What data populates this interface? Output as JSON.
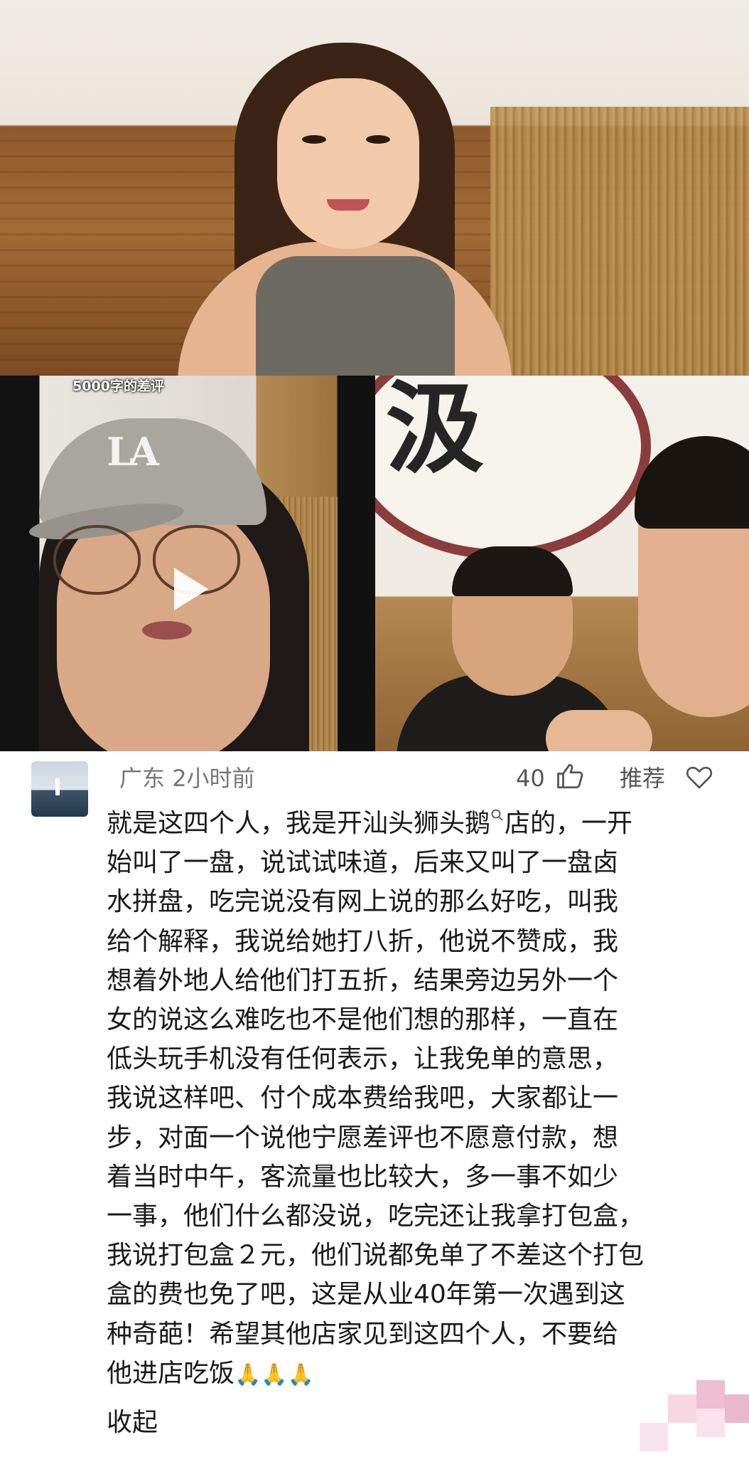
{
  "video_left": {
    "caption": "5000字的差评",
    "cap_logo": "LA"
  },
  "video_right": {
    "sign_char": "汲"
  },
  "comment": {
    "location": "广东",
    "time": "2小时前",
    "like_count": "40",
    "recommend_label": "推荐",
    "lines": [
      "就是这四个人，我是开汕头狮头鹅",
      "始叫了一盘，说试试味道，后来又叫了一盘卤",
      "水拼盘，吃完说没有网上说的那么好吃，叫我",
      "给个解释，我说给她打八折，他说不赞成，我",
      "想着外地人给他们打五折，结果旁边另外一个",
      "女的说这么难吃也不是他们想的那样，一直在",
      "低头玩手机没有任何表示，让我免单的意思，",
      "我说这样吧、付个成本费给我吧，大家都让一",
      "步，对面一个说他宁愿差评也不愿意付款，想",
      "着当时中午，客流量也比较大，多一事不如少",
      "一事，他们什么都没说，吃完还让我拿打包盒，",
      "我说打包盒２元，他们说都免单了不差这个打包",
      "盒的费也免了吧，这是从业40年第一次遇到这",
      "种奇葩！希望其他店家见到这四个人，不要给",
      "他进店吃饭"
    ],
    "line1_tail": "店的，一开",
    "emoji": "🙏🙏🙏",
    "collapse_label": "收起"
  },
  "icons": {
    "like": "thumbs-up-icon",
    "recommend": "heart-icon",
    "search": "search-icon",
    "play": "play-icon"
  },
  "colors": {
    "meta_text": "#777777",
    "body_text": "#1a1a1a",
    "background": "#ffffff"
  }
}
